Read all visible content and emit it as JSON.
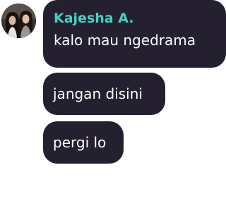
{
  "chat": {
    "sender": {
      "name": "Kajesha A.",
      "avatar_icon": "profile-photo-two-people",
      "name_color": "#43d3c3"
    },
    "bubble_color": "#25202f",
    "messages": [
      {
        "text": "kalo mau ngedrama"
      },
      {
        "text": "jangan disini"
      },
      {
        "text": "pergi lo"
      }
    ]
  }
}
